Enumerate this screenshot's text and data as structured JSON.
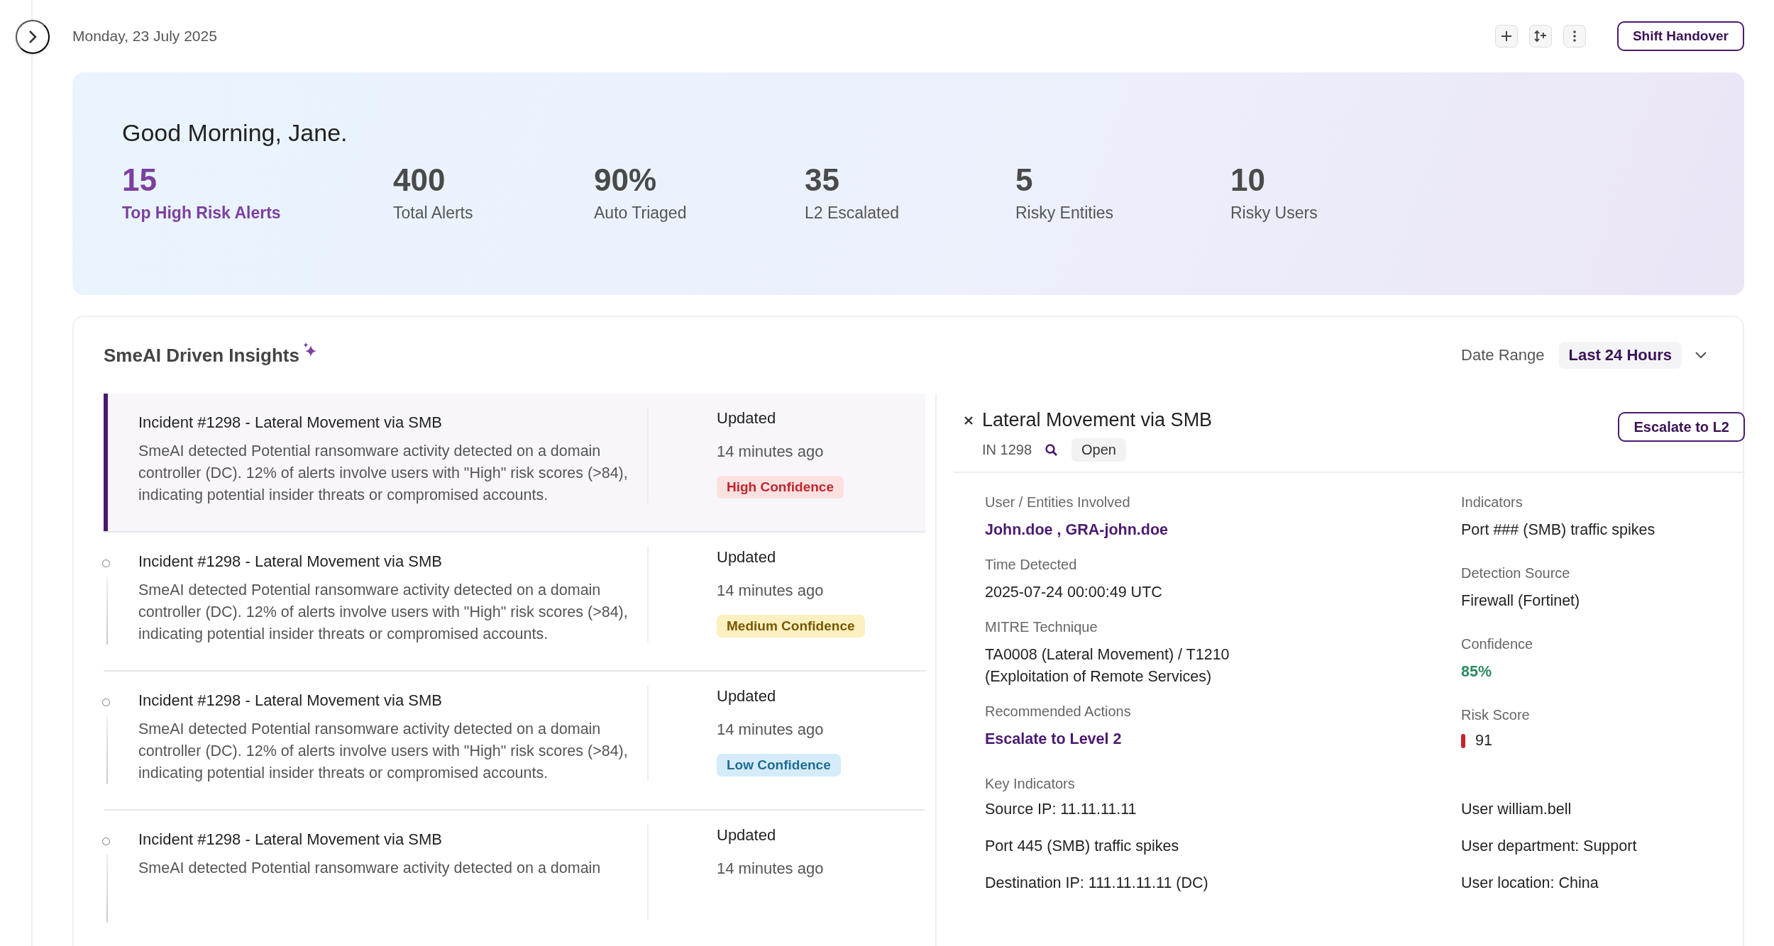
{
  "header": {
    "date": "Monday, 23 July 2025",
    "shift_button": "Shift Handover"
  },
  "banner": {
    "greeting": "Good Morning, Jane.",
    "stats": [
      {
        "value": "15",
        "label": "Top High Risk Alerts",
        "selected": true
      },
      {
        "value": "400",
        "label": "Total Alerts",
        "selected": false
      },
      {
        "value": "90%",
        "label": "Auto Triaged",
        "selected": false
      },
      {
        "value": "35",
        "label": "L2 Escalated",
        "selected": false
      },
      {
        "value": "5",
        "label": "Risky Entities",
        "selected": false
      },
      {
        "value": "10",
        "label": "Risky Users",
        "selected": false
      }
    ]
  },
  "insights": {
    "title": "SmeAI Driven Insights",
    "date_range_label": "Date Range",
    "date_range_value": "Last 24 Hours",
    "incidents": [
      {
        "title": "Incident #1298 - Lateral Movement via SMB",
        "description": "SmeAI detected Potential ransomware activity detected on a domain controller (DC). 12% of alerts involve users with \"High\" risk scores (>84), indicating potential insider threats or compromised accounts.",
        "updated_label": "Updated",
        "time": "14 minutes ago",
        "confidence": {
          "label": "High Confidence",
          "kind": "high"
        },
        "selected": true
      },
      {
        "title": "Incident #1298 - Lateral Movement via SMB",
        "description": "SmeAI detected Potential ransomware activity detected on a domain controller (DC). 12% of alerts involve users with \"High\" risk scores (>84), indicating potential insider threats or compromised accounts.",
        "updated_label": "Updated",
        "time": "14 minutes ago",
        "confidence": {
          "label": "Medium Confidence",
          "kind": "medium"
        },
        "selected": false
      },
      {
        "title": "Incident #1298 - Lateral Movement via SMB",
        "description": "SmeAI detected Potential ransomware activity detected on a domain controller (DC). 12% of alerts involve users with \"High\" risk scores (>84), indicating potential insider threats or compromised accounts.",
        "updated_label": "Updated",
        "time": "14 minutes ago",
        "confidence": {
          "label": "Low Confidence",
          "kind": "low"
        },
        "selected": false
      },
      {
        "title": "Incident #1298 - Lateral Movement via SMB",
        "description": "SmeAI detected Potential ransomware activity detected on a domain",
        "updated_label": "Updated",
        "time": "14 minutes ago",
        "selected": false
      }
    ],
    "detail": {
      "title": "Lateral Movement via SMB",
      "id": "IN 1298",
      "status": "Open",
      "escalate_button": "Escalate to L2",
      "left_fields": [
        {
          "label": "User / Entities Involved",
          "value": "John.doe , GRA-john.doe",
          "kind": "link"
        },
        {
          "label": "Time Detected",
          "value": "2025-07-24 00:00:49 UTC",
          "kind": "text"
        },
        {
          "label": "MITRE Technique",
          "value": "TA0008 (Lateral Movement) / T1210 (Exploitation of Remote Services)",
          "kind": "text"
        },
        {
          "label": "Recommended Actions",
          "value": "Escalate to Level 2",
          "kind": "link"
        }
      ],
      "right_fields": [
        {
          "label": "Indicators",
          "value": "Port ### (SMB) traffic spikes",
          "kind": "text"
        },
        {
          "label": "Detection Source",
          "value": "Firewall (Fortinet)",
          "kind": "text"
        },
        {
          "label": "Confidence",
          "value": "85%",
          "kind": "success"
        },
        {
          "label": "Risk Score",
          "value": "91",
          "kind": "risk"
        }
      ],
      "key_indicators": {
        "label": "Key Indicators",
        "left": [
          "Source IP: 11.11.11.11",
          "Port 445 (SMB) traffic spikes",
          "Destination IP: 111.11.11.11 (DC)"
        ],
        "right": [
          "User william.bell",
          "User department: Support",
          "User location: China"
        ]
      }
    }
  }
}
